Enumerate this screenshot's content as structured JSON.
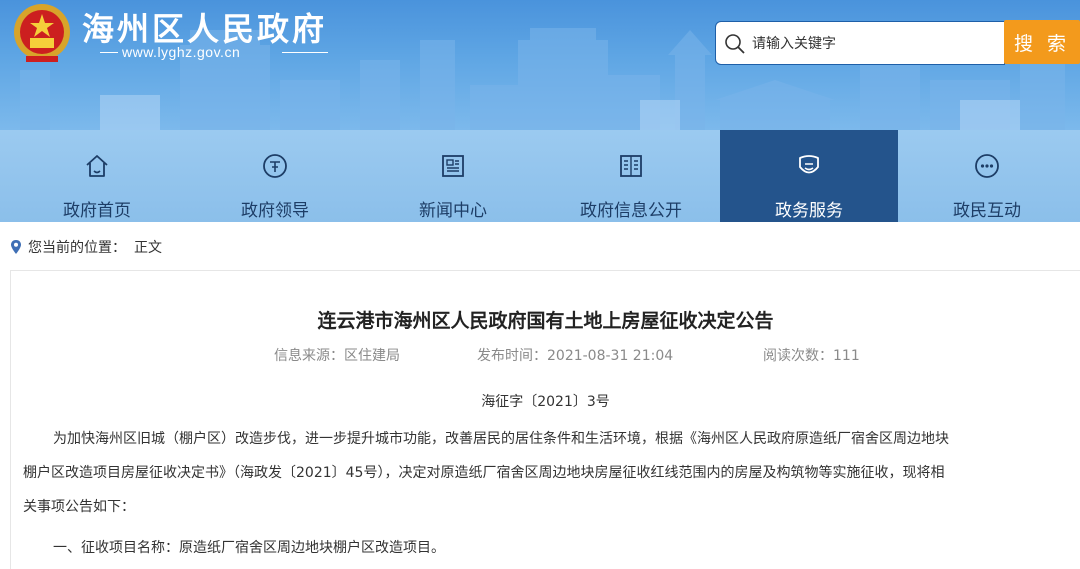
{
  "header": {
    "site_name": "海州区人民政府",
    "site_url": "www.lyghz.gov.cn",
    "search_placeholder": "请输入关键字",
    "search_button": "搜 索"
  },
  "nav": {
    "items": [
      {
        "label": "政府首页",
        "icon": "home-icon"
      },
      {
        "label": "政府领导",
        "icon": "leader-badge-icon"
      },
      {
        "label": "新闻中心",
        "icon": "newspaper-icon"
      },
      {
        "label": "政府信息公开",
        "icon": "document-list-icon"
      },
      {
        "label": "政务服务",
        "icon": "service-shield-icon",
        "active": true
      },
      {
        "label": "政民互动",
        "icon": "chat-dots-icon"
      }
    ]
  },
  "breadcrumb": {
    "prefix": "您当前的位置：",
    "current": "正文"
  },
  "article": {
    "title": "连云港市海州区人民政府国有土地上房屋征收决定公告",
    "source": "信息来源：区住建局",
    "publish_time": "发布时间：2021-08-31 21:04",
    "views": "阅读次数：111",
    "doc_number": "海征字〔2021〕3号",
    "para1_line1": "为加快海州区旧城（棚户区）改造步伐，进一步提升城市功能，改善居民的居住条件和生活环境，根据《海州区人民政府原造纸厂宿舍区周边地块",
    "para1_line2": "棚户区改造项目房屋征收决定书》（海政发〔2021〕45号），决定对原造纸厂宿舍区周边地块房屋征收红线范围内的房屋及构筑物等实施征收，现将相",
    "para1_line3": "关事项公告如下：",
    "para2": "一、征收项目名称：原造纸厂宿舍区周边地块棚户区改造项目。"
  },
  "colors": {
    "header_blue": "#4a93dc",
    "nav_light": "#9bcaf0",
    "nav_active": "#24548c",
    "search_orange": "#f39a1c"
  }
}
